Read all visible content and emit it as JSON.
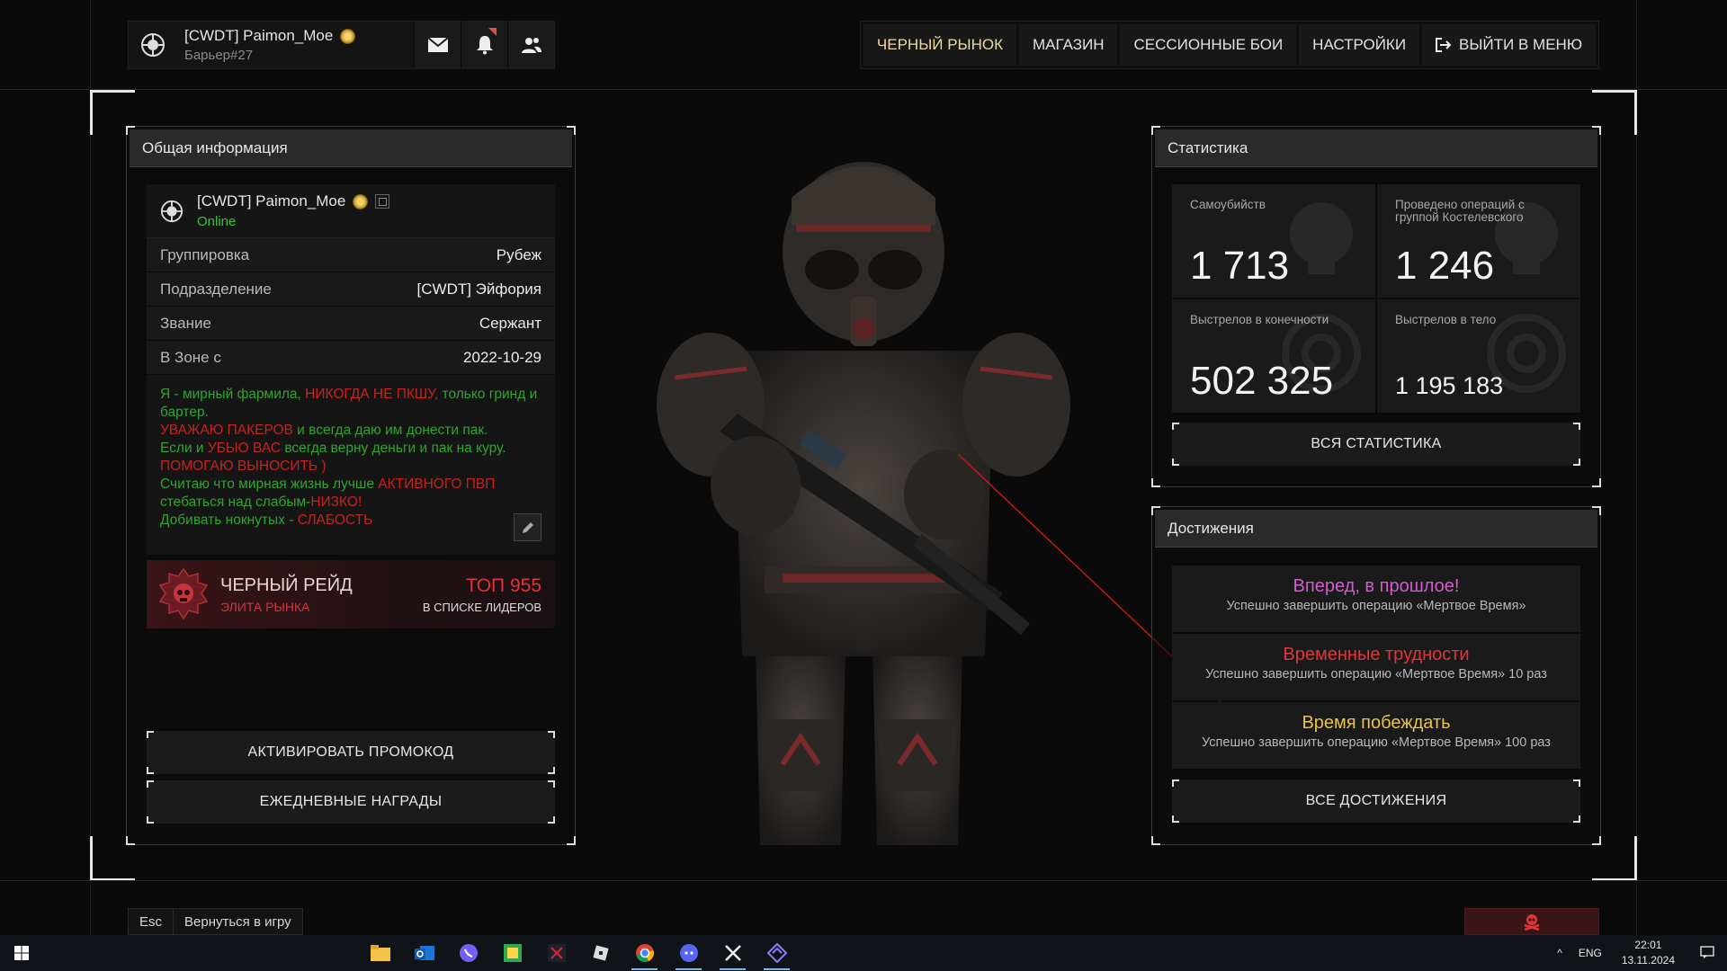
{
  "header": {
    "nick": "[CWDT] Paimon_Moe",
    "sub": "Барьер#27",
    "nav": [
      {
        "label": "ЧЕРНЫЙ РЫНОК"
      },
      {
        "label": "МАГАЗИН"
      },
      {
        "label": "СЕССИОННЫЕ БОИ"
      },
      {
        "label": "НАСТРОЙКИ"
      },
      {
        "label": "ВЫЙТИ В МЕНЮ"
      }
    ]
  },
  "info": {
    "title": "Общая информация",
    "nick": "[CWDT] Paimon_Moe",
    "status": "Online",
    "rows": [
      {
        "k": "Группировка",
        "v": "Рубеж"
      },
      {
        "k": "Подразделение",
        "v": "[CWDT] Эйфория"
      },
      {
        "k": "Звание",
        "v": "Сержант"
      },
      {
        "k": "В Зоне с",
        "v": "2022-10-29"
      }
    ],
    "bio": [
      {
        "t": "Я - мирный фармила, ",
        "c": "g"
      },
      {
        "t": "НИКОГДА НЕ ПКШУ, ",
        "c": "r"
      },
      {
        "t": "только гринд и бартер.",
        "c": "g"
      },
      {
        "t": "УВАЖАЮ ПАКЕРОВ ",
        "c": "r",
        "br": true
      },
      {
        "t": "и всегда даю им донести пак.",
        "c": "g"
      },
      {
        "t": "Если и ",
        "c": "g",
        "br": true
      },
      {
        "t": "УБЫО ВАС ",
        "c": "r"
      },
      {
        "t": "всегда верну деньги и пак на куру.",
        "c": "g"
      },
      {
        "t": "ПОМОГАЮ ВЫНОСИТЬ )",
        "c": "r",
        "br": true
      },
      {
        "t": "Считаю что мирная жизнь лучше ",
        "c": "g",
        "br": true
      },
      {
        "t": "АКТИВНОГО ПВП",
        "c": "r"
      },
      {
        "t": "стебаться над слабым-",
        "c": "g",
        "br": true
      },
      {
        "t": "НИЗКО!",
        "c": "r"
      },
      {
        "t": "Добивать нокнутых - ",
        "c": "g",
        "br": true
      },
      {
        "t": "СЛАБОСТЬ",
        "c": "r"
      }
    ],
    "raid": {
      "title": "ЧЕРНЫЙ РЕЙД",
      "subtitle": "ЭЛИТА РЫНКА",
      "top": "ТОП 955",
      "top_sub": "В СПИСКЕ ЛИДЕРОВ"
    },
    "promo_btn": "АКТИВИРОВАТЬ ПРОМОКОД",
    "daily_btn": "ЕЖЕДНЕВНЫЕ НАГРАДЫ"
  },
  "stats": {
    "title": "Статистика",
    "items": [
      {
        "label": "Самоубийств",
        "value": "1 713"
      },
      {
        "label": "Проведено операций с группой Костелевского",
        "value": "1 246"
      },
      {
        "label": "Выстрелов в конечности",
        "value": "502 325"
      },
      {
        "label": "Выстрелов в тело",
        "value": "1 195 183"
      }
    ],
    "all_btn": "ВСЯ СТАТИСТИКА"
  },
  "achievements": {
    "title": "Достижения",
    "items": [
      {
        "title": "Вперед, в прошлое!",
        "desc": "Успешно завершить операцию «Мертвое Время»",
        "color": "#d45bd0"
      },
      {
        "title": "Временные трудности",
        "desc": "Успешно завершить операцию «Мертвое Время» 10 раз",
        "color": "#e0353a"
      },
      {
        "title": "Время побеждать",
        "desc": "Успешно завершить операцию «Мертвое Время» 100 раз",
        "color": "#e8c24a"
      }
    ],
    "all_btn": "ВСЕ ДОСТИЖЕНИЯ"
  },
  "bottom": {
    "esc_key": "Esc",
    "esc_label": "Вернуться в игру"
  },
  "taskbar": {
    "lang": "ENG",
    "time": "22:01",
    "date": "13.11.2024"
  }
}
